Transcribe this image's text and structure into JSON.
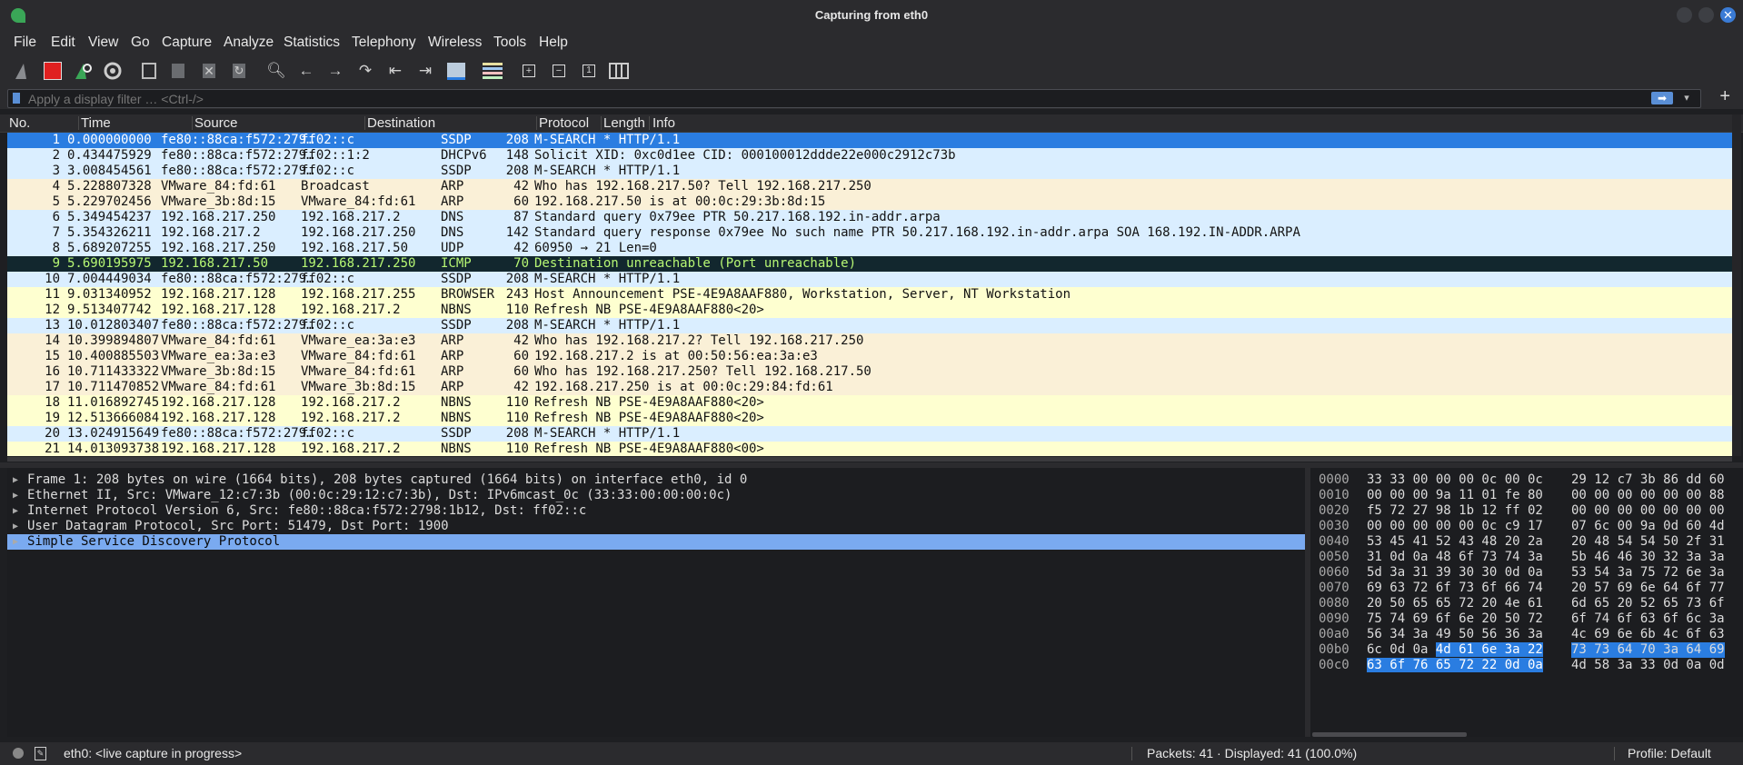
{
  "window": {
    "title": "Capturing from eth0"
  },
  "menu": [
    "File",
    "Edit",
    "View",
    "Go",
    "Capture",
    "Analyze",
    "Statistics",
    "Telephony",
    "Wireless",
    "Tools",
    "Help"
  ],
  "toolbar_icons": [
    "shark-fin-start-icon",
    "stop-capture-icon",
    "restart-capture-icon",
    "capture-options-icon",
    "open-file-icon",
    "save-file-icon",
    "close-file-icon",
    "reload-file-icon",
    "find-packet-icon",
    "go-back-icon",
    "go-forward-icon",
    "go-to-packet-icon",
    "go-first-icon",
    "go-last-icon",
    "autoscroll-icon",
    "colorize-icon",
    "zoom-in-icon",
    "zoom-out-icon",
    "zoom-normal-icon",
    "resize-columns-icon"
  ],
  "filter": {
    "placeholder": "Apply a display filter … <Ctrl-/>"
  },
  "columns": [
    "No.",
    "Time",
    "Source",
    "Destination",
    "Protocol",
    "Length",
    "Info"
  ],
  "colors": {
    "selected": "#2a7de1",
    "ssdp_dhcp_dns": "#daeeff",
    "arp_udp": "#faf0d7",
    "nbns_browser": "#feffd0",
    "icmp_error_bg": "#12272e",
    "icmp_error_fg": "#b7f774"
  },
  "packets": [
    {
      "no": "1",
      "time": "0.000000000",
      "src": "fe80::88ca:f572:279…",
      "dst": "ff02::c",
      "proto": "SSDP",
      "len": "208",
      "info": "M-SEARCH * HTTP/1.1",
      "style": "selected"
    },
    {
      "no": "2",
      "time": "0.434475929",
      "src": "fe80::88ca:f572:279…",
      "dst": "ff02::1:2",
      "proto": "DHCPv6",
      "len": "148",
      "info": "Solicit XID: 0xc0d1ee CID: 000100012ddde22e000c2912c73b",
      "style": "blue"
    },
    {
      "no": "3",
      "time": "3.008454561",
      "src": "fe80::88ca:f572:279…",
      "dst": "ff02::c",
      "proto": "SSDP",
      "len": "208",
      "info": "M-SEARCH * HTTP/1.1",
      "style": "blue"
    },
    {
      "no": "4",
      "time": "5.228807328",
      "src": "VMware_84:fd:61",
      "dst": "Broadcast",
      "proto": "ARP",
      "len": "42",
      "info": "Who has 192.168.217.50? Tell 192.168.217.250",
      "style": "tan"
    },
    {
      "no": "5",
      "time": "5.229702456",
      "src": "VMware_3b:8d:15",
      "dst": "VMware_84:fd:61",
      "proto": "ARP",
      "len": "60",
      "info": "192.168.217.50 is at 00:0c:29:3b:8d:15",
      "style": "tan"
    },
    {
      "no": "6",
      "time": "5.349454237",
      "src": "192.168.217.250",
      "dst": "192.168.217.2",
      "proto": "DNS",
      "len": "87",
      "info": "Standard query 0x79ee PTR 50.217.168.192.in-addr.arpa",
      "style": "blue"
    },
    {
      "no": "7",
      "time": "5.354326211",
      "src": "192.168.217.2",
      "dst": "192.168.217.250",
      "proto": "DNS",
      "len": "142",
      "info": "Standard query response 0x79ee No such name PTR 50.217.168.192.in-addr.arpa SOA 168.192.IN-ADDR.ARPA",
      "style": "blue"
    },
    {
      "no": "8",
      "time": "5.689207255",
      "src": "192.168.217.250",
      "dst": "192.168.217.50",
      "proto": "UDP",
      "len": "42",
      "info": "60950 → 21 Len=0",
      "style": "blue"
    },
    {
      "no": "9",
      "time": "5.690195975",
      "src": "192.168.217.50",
      "dst": "192.168.217.250",
      "proto": "ICMP",
      "len": "70",
      "info": "Destination unreachable (Port unreachable)",
      "style": "dark"
    },
    {
      "no": "10",
      "time": "7.004449034",
      "src": "fe80::88ca:f572:279…",
      "dst": "ff02::c",
      "proto": "SSDP",
      "len": "208",
      "info": "M-SEARCH * HTTP/1.1",
      "style": "blue"
    },
    {
      "no": "11",
      "time": "9.031340952",
      "src": "192.168.217.128",
      "dst": "192.168.217.255",
      "proto": "BROWSER",
      "len": "243",
      "info": "Host Announcement PSE-4E9A8AAF880, Workstation, Server, NT Workstation",
      "style": "yellow"
    },
    {
      "no": "12",
      "time": "9.513407742",
      "src": "192.168.217.128",
      "dst": "192.168.217.2",
      "proto": "NBNS",
      "len": "110",
      "info": "Refresh NB PSE-4E9A8AAF880<20>",
      "style": "yellow"
    },
    {
      "no": "13",
      "time": "10.012803407",
      "src": "fe80::88ca:f572:279…",
      "dst": "ff02::c",
      "proto": "SSDP",
      "len": "208",
      "info": "M-SEARCH * HTTP/1.1",
      "style": "blue"
    },
    {
      "no": "14",
      "time": "10.399894807",
      "src": "VMware_84:fd:61",
      "dst": "VMware_ea:3a:e3",
      "proto": "ARP",
      "len": "42",
      "info": "Who has 192.168.217.2? Tell 192.168.217.250",
      "style": "tan"
    },
    {
      "no": "15",
      "time": "10.400885503",
      "src": "VMware_ea:3a:e3",
      "dst": "VMware_84:fd:61",
      "proto": "ARP",
      "len": "60",
      "info": "192.168.217.2 is at 00:50:56:ea:3a:e3",
      "style": "tan"
    },
    {
      "no": "16",
      "time": "10.711433322",
      "src": "VMware_3b:8d:15",
      "dst": "VMware_84:fd:61",
      "proto": "ARP",
      "len": "60",
      "info": "Who has 192.168.217.250? Tell 192.168.217.50",
      "style": "tan"
    },
    {
      "no": "17",
      "time": "10.711470852",
      "src": "VMware_84:fd:61",
      "dst": "VMware_3b:8d:15",
      "proto": "ARP",
      "len": "42",
      "info": "192.168.217.250 is at 00:0c:29:84:fd:61",
      "style": "tan"
    },
    {
      "no": "18",
      "time": "11.016892745",
      "src": "192.168.217.128",
      "dst": "192.168.217.2",
      "proto": "NBNS",
      "len": "110",
      "info": "Refresh NB PSE-4E9A8AAF880<20>",
      "style": "yellow"
    },
    {
      "no": "19",
      "time": "12.513666084",
      "src": "192.168.217.128",
      "dst": "192.168.217.2",
      "proto": "NBNS",
      "len": "110",
      "info": "Refresh NB PSE-4E9A8AAF880<20>",
      "style": "yellow"
    },
    {
      "no": "20",
      "time": "13.024915649",
      "src": "fe80::88ca:f572:279…",
      "dst": "ff02::c",
      "proto": "SSDP",
      "len": "208",
      "info": "M-SEARCH * HTTP/1.1",
      "style": "blue"
    },
    {
      "no": "21",
      "time": "14.013093738",
      "src": "192.168.217.128",
      "dst": "192.168.217.2",
      "proto": "NBNS",
      "len": "110",
      "info": "Refresh NB PSE-4E9A8AAF880<00>",
      "style": "yellow"
    }
  ],
  "details": [
    {
      "text": "Frame 1: 208 bytes on wire (1664 bits), 208 bytes captured (1664 bits) on interface eth0, id 0",
      "selected": false
    },
    {
      "text": "Ethernet II, Src: VMware_12:c7:3b (00:0c:29:12:c7:3b), Dst: IPv6mcast_0c (33:33:00:00:00:0c)",
      "selected": false
    },
    {
      "text": "Internet Protocol Version 6, Src: fe80::88ca:f572:2798:1b12, Dst: ff02::c",
      "selected": false
    },
    {
      "text": "User Datagram Protocol, Src Port: 51479, Dst Port: 1900",
      "selected": false
    },
    {
      "text": "Simple Service Discovery Protocol",
      "selected": true
    }
  ],
  "bytes": [
    {
      "off": "0000",
      "h1": "33 33 00 00 00 0c 00 0c",
      "h2": "29 12 c7 3b 86 dd 60"
    },
    {
      "off": "0010",
      "h1": "00 00 00 9a 11 01 fe 80",
      "h2": "00 00 00 00 00 00 88"
    },
    {
      "off": "0020",
      "h1": "f5 72 27 98 1b 12 ff 02",
      "h2": "00 00 00 00 00 00 00"
    },
    {
      "off": "0030",
      "h1": "00 00 00 00 00 0c c9 17",
      "h2": "07 6c 00 9a 0d 60 4d"
    },
    {
      "off": "0040",
      "h1": "53 45 41 52 43 48 20 2a",
      "h2": "20 48 54 54 50 2f 31"
    },
    {
      "off": "0050",
      "h1": "31 0d 0a 48 6f 73 74 3a",
      "h2": "5b 46 46 30 32 3a 3a"
    },
    {
      "off": "0060",
      "h1": "5d 3a 31 39 30 30 0d 0a",
      "h2": "53 54 3a 75 72 6e 3a"
    },
    {
      "off": "0070",
      "h1": "69 63 72 6f 73 6f 66 74",
      "h2": "20 57 69 6e 64 6f 77"
    },
    {
      "off": "0080",
      "h1": "20 50 65 65 72 20 4e 61",
      "h2": "6d 65 20 52 65 73 6f"
    },
    {
      "off": "0090",
      "h1": "75 74 69 6f 6e 20 50 72",
      "h2": "6f 74 6f 63 6f 6c 3a"
    },
    {
      "off": "00a0",
      "h1": "56 34 3a 49 50 56 36 3a",
      "h2": "4c 69 6e 6b 4c 6f 63"
    },
    {
      "off": "00b0",
      "h1": "6c 0d 0a ",
      "h1hl": "4d 61 6e 3a 22",
      "h2": "73 73 64 70 3a 64 69",
      "h2hl": true
    },
    {
      "off": "00c0",
      "h1": "",
      "h1hl": "63 6f 76 65 72 22 0d 0a",
      "h2": "4d 58 3a 33 0d 0a 0d",
      "h2hl": false
    }
  ],
  "status": {
    "interface": "eth0: <live capture in progress>",
    "packets": "Packets: 41 · Displayed: 41 (100.0%)",
    "profile": "Profile: Default"
  }
}
